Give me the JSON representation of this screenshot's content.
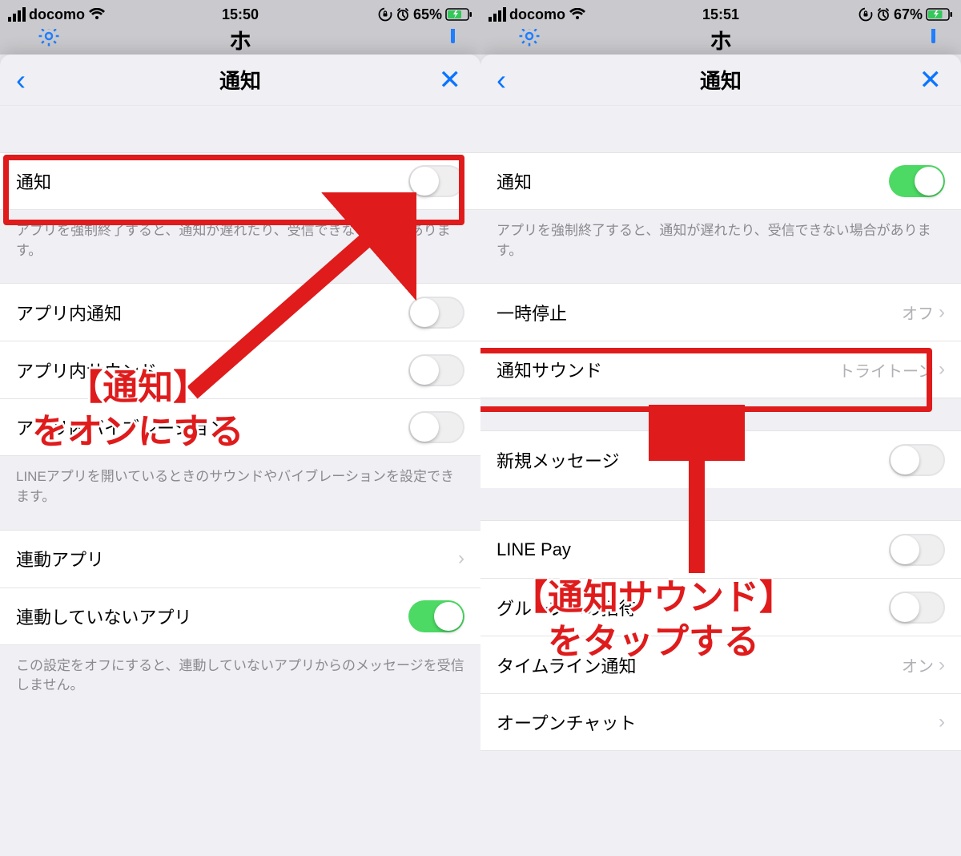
{
  "left": {
    "status": {
      "carrier": "docomo",
      "time": "15:50",
      "battery": "65%"
    },
    "partialTitle": "ホ",
    "sheetTitle": "通知",
    "cells": {
      "notify": "通知",
      "caption1": "アプリを強制終了すると、通知が遅れたり、受信できない場合があります。",
      "inAppNotify": "アプリ内通知",
      "inAppSound": "アプリ内サウンド",
      "inAppVibe": "アプリ内バイブレーション",
      "caption2": "LINEアプリを開いているときのサウンドやバイブレーションを設定できます。",
      "linkedApps": "連動アプリ",
      "unlinkedApps": "連動していないアプリ",
      "caption3": "この設定をオフにすると、連動していないアプリからのメッセージを受信しません。"
    },
    "annotation": "【通知】\nをオンにする"
  },
  "right": {
    "status": {
      "carrier": "docomo",
      "time": "15:51",
      "battery": "67%"
    },
    "partialTitle": "ホ",
    "sheetTitle": "通知",
    "cells": {
      "notify": "通知",
      "caption1": "アプリを強制終了すると、通知が遅れたり、受信できない場合があります。",
      "pause": "一時停止",
      "pauseValue": "オフ",
      "sound": "通知サウンド",
      "soundValue": "トライトーン",
      "newMsg": "新規メッセージ",
      "linePay": "LINE Pay",
      "groupInvite": "グループへの招待",
      "timeline": "タイムライン通知",
      "timelineValue": "オン",
      "openChat": "オープンチャット"
    },
    "annotation": "【通知サウンド】\nをタップする"
  }
}
